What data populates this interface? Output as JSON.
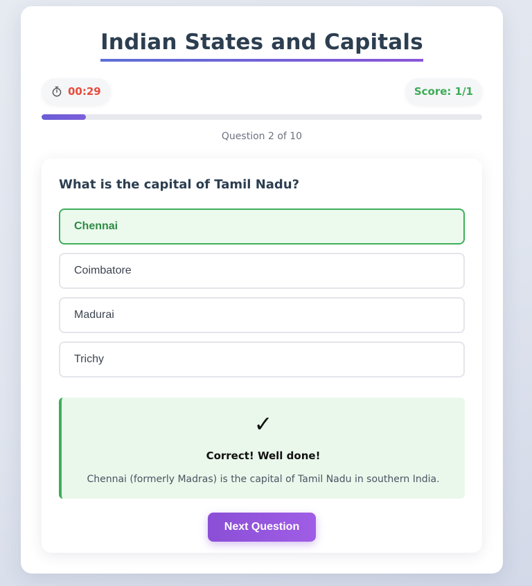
{
  "app": {
    "title": "Indian States and Capitals"
  },
  "status": {
    "timer": "00:29",
    "score": "Score: 1/1"
  },
  "progress": {
    "fraction": 0.1,
    "counter": "Question 2 of 10"
  },
  "question": {
    "text": "What is the capital of Tamil Nadu?",
    "options": [
      {
        "label": "Chennai",
        "state": "correct"
      },
      {
        "label": "Coimbatore",
        "state": "default"
      },
      {
        "label": "Madurai",
        "state": "default"
      },
      {
        "label": "Trichy",
        "state": "default"
      }
    ]
  },
  "feedback": {
    "icon": "check-icon",
    "symbol": "✓",
    "title": "Correct! Well done!",
    "text": "Chennai (formerly Madras) is the capital of Tamil Nadu in southern India."
  },
  "actions": {
    "next_label": "Next Question"
  },
  "colors": {
    "accent": "#6a5ed6",
    "correct": "#3dae5a",
    "timer": "#e74c3c",
    "button": "#9a57e0"
  }
}
